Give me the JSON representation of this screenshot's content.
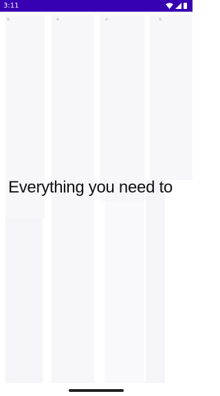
{
  "status_bar": {
    "time": "3:11",
    "background_color": "#3700b3",
    "icons": [
      "wifi-icon",
      "signal-icon",
      "battery-icon"
    ]
  },
  "main": {
    "headline": "Everything you need to"
  },
  "colors": {
    "placeholder_block": "#f7f6f9",
    "headline_text": "#111111"
  }
}
